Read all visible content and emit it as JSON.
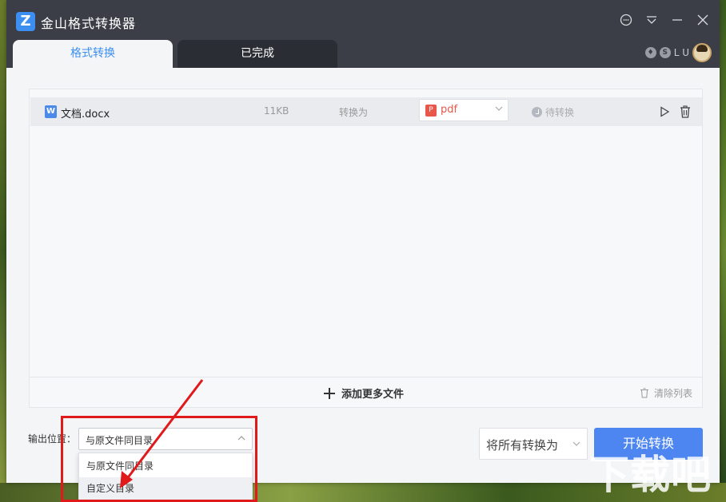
{
  "app": {
    "title": "金山格式转换器",
    "logo_letter": "Z"
  },
  "titlebar": {
    "icons": [
      "chat-icon",
      "menu-icon",
      "minimize-icon",
      "close-icon"
    ]
  },
  "tabs": [
    {
      "label": "格式转换",
      "active": true
    },
    {
      "label": "已完成",
      "active": false
    }
  ],
  "user": {
    "level_text": "L U",
    "avatar": "avatar"
  },
  "file_list": {
    "rows": [
      {
        "icon_letter": "W",
        "name": "文档.docx",
        "size": "11KB",
        "convert_label": "转换为",
        "format": "pdf",
        "format_icon": "P",
        "status": "待转换"
      }
    ],
    "add_more_label": "添加更多文件",
    "clear_list_label": "清除列表"
  },
  "output": {
    "label": "输出位置：",
    "selected": "与原文件同目录",
    "options": [
      "与原文件同目录",
      "自定义目录"
    ]
  },
  "convert_all": {
    "label": "将所有转换为"
  },
  "start_button": {
    "label": "开始转换"
  },
  "colors": {
    "accent": "#4d86f0",
    "titlebar": "#3b3e47",
    "pdf_red": "#e8574a",
    "annotation_red": "#e0191a"
  },
  "watermark": "下载吧"
}
